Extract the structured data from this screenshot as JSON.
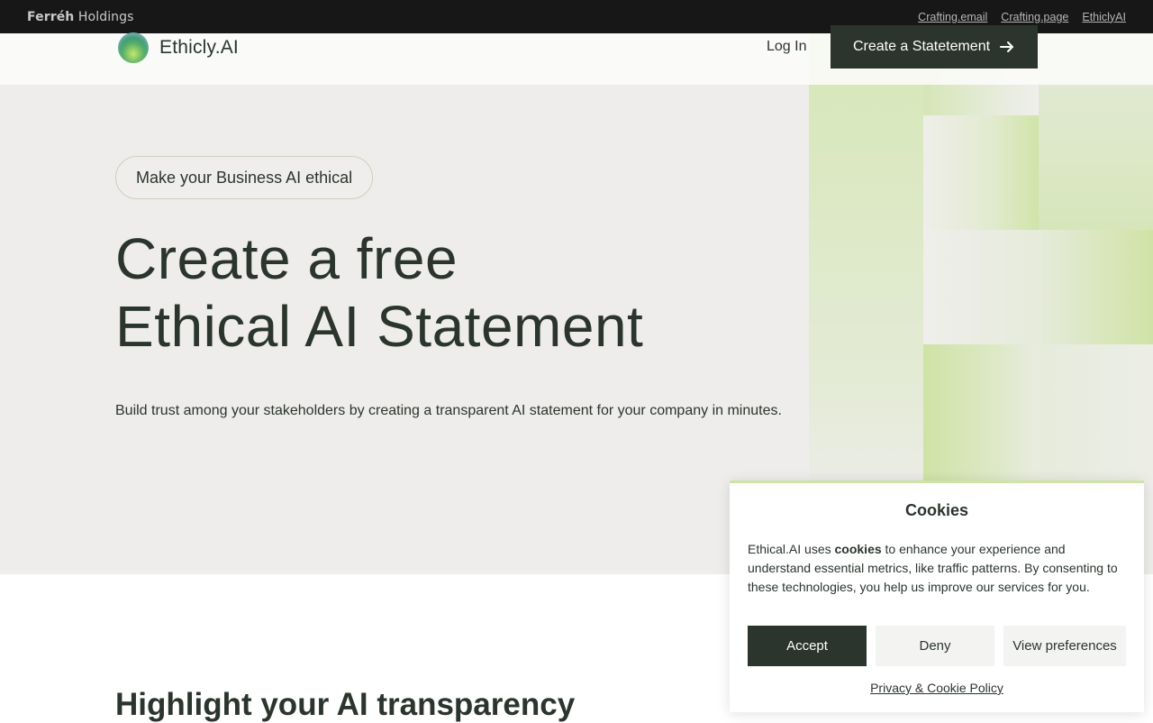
{
  "topbar": {
    "brand_bold": "Ferréh",
    "brand_rest": " Holdings",
    "links": [
      "Crafting.email",
      "Crafting.page",
      "EthiclyAI"
    ]
  },
  "nav": {
    "logo_text": "Ethicly.AI",
    "login_label": "Log In",
    "cta_label": "Create a Statetement",
    "cta_icon": "arrow-right-icon"
  },
  "hero": {
    "pill_label": "Make your Business AI ethical",
    "headline_line1": "Create a free",
    "headline_line2": "Ethical AI Statement",
    "subtext": "Build trust among your stakeholders by creating a transparent AI statement for your company in minutes."
  },
  "section": {
    "title": "Highlight your AI transparency"
  },
  "cookie": {
    "title": "Cookies",
    "text_before": "Ethical.AI uses ",
    "text_bold": "cookies",
    "text_after": " to enhance your experience and understand essential metrics, like traffic patterns. By consenting to these technologies, you help us improve our services for you.",
    "accept_label": "Accept",
    "deny_label": "Deny",
    "prefs_label": "View preferences",
    "policy_label": "Privacy & Cookie Policy"
  },
  "colors": {
    "dark": "#2b352d",
    "accent_green": "#cfe3a8",
    "hero_bg": "#eeedeb",
    "topbar_bg": "#171717"
  }
}
